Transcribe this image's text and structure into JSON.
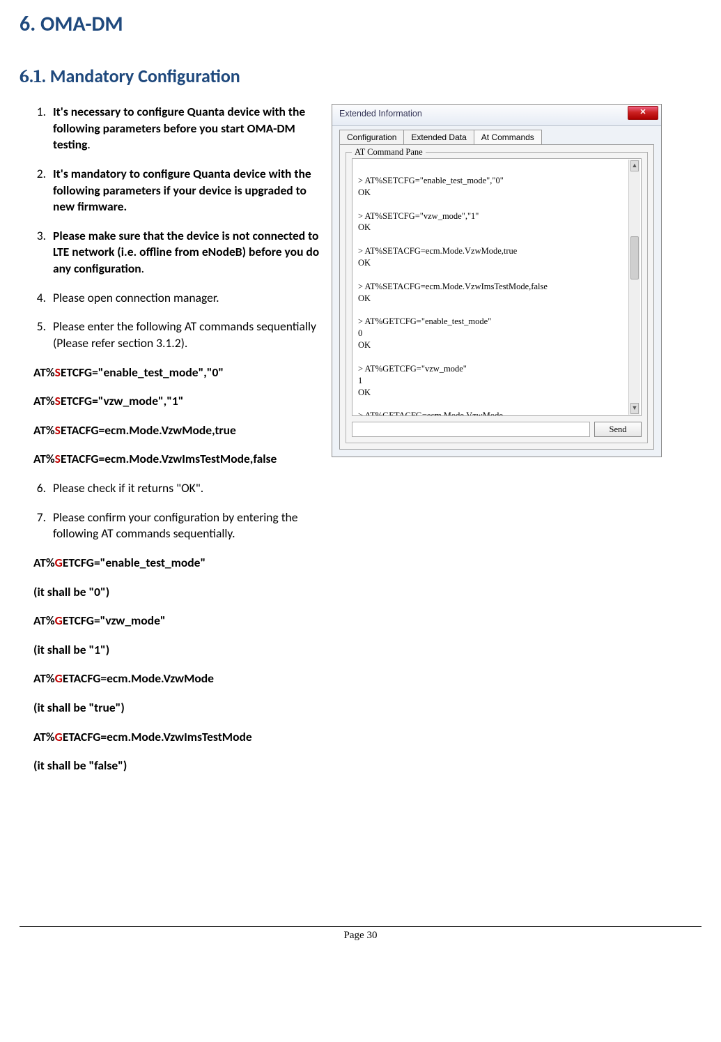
{
  "h1": {
    "num": "6.",
    "title": "OMA-DM"
  },
  "h2": {
    "num": "6.1.",
    "title": "Mandatory Configuration"
  },
  "list": {
    "i1": "It's necessary to configure Quanta device with the following parameters before you start OMA-DM testing",
    "i1tail": ".",
    "i2": "It's mandatory to configure Quanta device with the following parameters if your device is upgraded to new firmware.",
    "i3": "Please make sure that the device is not connected to LTE network (i.e. offline from eNodeB) before you do any configuration",
    "i3tail": ".",
    "i4": "Please open connection manager.",
    "i5": "Please enter the following AT commands sequentially (Please refer section 3.1.2).",
    "i6": "Please check if it returns \"OK\".",
    "i7": "Please confirm your configuration by entering the following AT commands sequentially."
  },
  "cmdsA": {
    "c1_pre": "AT%",
    "c1_S": "S",
    "c1_post": "ETCFG=\"enable_test_mode\",\"0\"",
    "c2_pre": "AT%",
    "c2_S": "S",
    "c2_post": "ETCFG=\"vzw_mode\",\"1\"",
    "c3_pre": "AT%",
    "c3_S": "S",
    "c3_post": "ETACFG=ecm.Mode.VzwMode,true",
    "c4_pre": "AT%",
    "c4_S": "S",
    "c4_post": "ETACFG=ecm.Mode.VzwImsTestMode,false"
  },
  "cmdsB": {
    "c1_pre": "AT%",
    "c1_G": "G",
    "c1_post": "ETCFG=\"enable_test_mode\"",
    "c1_note": "(it shall be \"0\")",
    "c2_pre": "AT%",
    "c2_G": "G",
    "c2_post": "ETCFG=\"vzw_mode\"",
    "c2_note": "(it shall be \"1\")",
    "c3_pre": "AT%",
    "c3_G": "G",
    "c3_post": "ETACFG=ecm.Mode.VzwMode",
    "c3_note": "(it shall be \"true\")",
    "c4_pre": "AT%",
    "c4_G": "G",
    "c4_post": "ETACFG=ecm.Mode.VzwImsTestMode",
    "c4_note": "(it shall be \"false\")"
  },
  "window": {
    "title": "Extended Information",
    "tabs": {
      "t1": "Configuration",
      "t2": "Extended Data",
      "t3": "At Commands"
    },
    "pane_label": "AT Command Pane",
    "console": "> AT%SETCFG=\"enable_test_mode\",\"0\"\nOK\n\n> AT%SETCFG=\"vzw_mode\",\"1\"\nOK\n\n> AT%SETACFG=ecm.Mode.VzwMode,true\nOK\n\n> AT%SETACFG=ecm.Mode.VzwImsTestMode,false\nOK\n\n> AT%GETCFG=\"enable_test_mode\"\n0\nOK\n\n> AT%GETCFG=\"vzw_mode\"\n1\nOK\n\n> AT%GETACFG=ecm.Mode.VzwMode\ntrue\nOK\n\n> AT%GETACFG=ecm.Mode.VzwImsTestMode\nfalse\nOK",
    "send_label": "Send"
  },
  "footer": "Page 30"
}
